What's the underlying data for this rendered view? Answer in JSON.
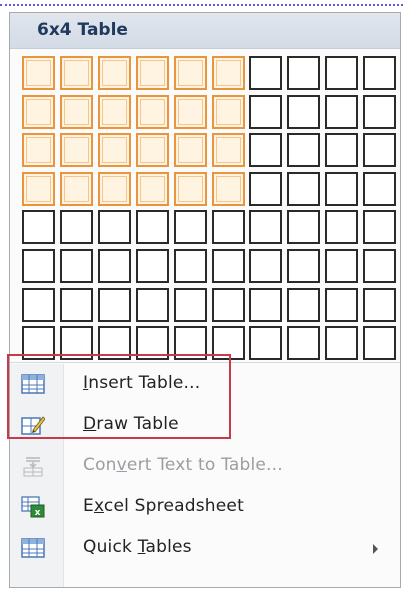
{
  "menu": {
    "title": "6x4 Table",
    "grid": {
      "columns": 10,
      "rows": 8,
      "selected_columns": 6,
      "selected_rows": 4
    },
    "items": [
      {
        "pre": "",
        "accel": "I",
        "post": "nsert Table...",
        "icon": "insert-table-icon",
        "enabled": true
      },
      {
        "pre": "",
        "accel": "D",
        "post": "raw Table",
        "icon": "draw-table-icon",
        "enabled": true
      },
      {
        "pre": "Con",
        "accel": "v",
        "post": "ert Text to Table...",
        "icon": "convert-text-to-table-icon",
        "enabled": false
      },
      {
        "pre": "E",
        "accel": "x",
        "post": "cel Spreadsheet",
        "icon": "excel-spreadsheet-icon",
        "enabled": true
      },
      {
        "pre": "Quick ",
        "accel": "T",
        "post": "ables",
        "icon": "quick-tables-icon",
        "enabled": true,
        "submenu": true
      }
    ]
  },
  "colors": {
    "selection_border": "#e8953d",
    "highlight_box": "#c63a4a"
  }
}
